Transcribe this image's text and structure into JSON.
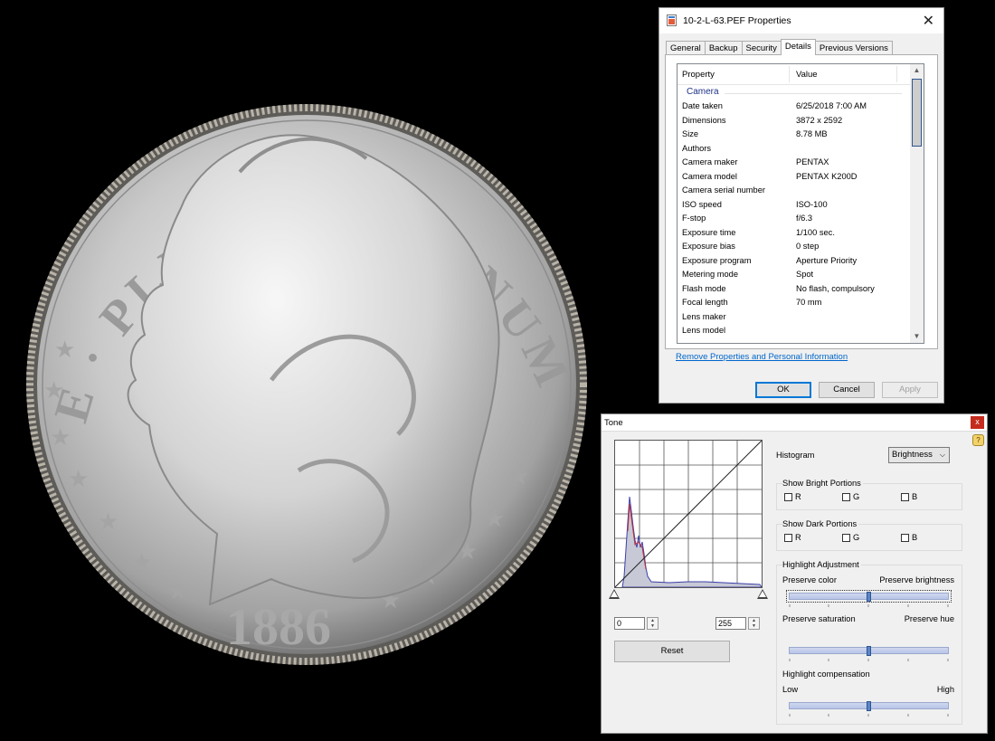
{
  "coin": {
    "legend": "E · PLURIBUS · UNUM",
    "year": "1886"
  },
  "properties": {
    "title": "10-2-L-63.PEF Properties",
    "tabs": [
      "General",
      "Backup",
      "Security",
      "Details",
      "Previous Versions"
    ],
    "active_tab": "Details",
    "columns": {
      "property": "Property",
      "value": "Value"
    },
    "group": "Camera",
    "rows": [
      {
        "property": "Date taken",
        "value": "6/25/2018 7:00 AM"
      },
      {
        "property": "Dimensions",
        "value": "3872 x 2592"
      },
      {
        "property": "Size",
        "value": "8.78 MB"
      },
      {
        "property": "Authors",
        "value": ""
      },
      {
        "property": "Camera maker",
        "value": "PENTAX"
      },
      {
        "property": "Camera model",
        "value": "PENTAX K200D"
      },
      {
        "property": "Camera serial number",
        "value": ""
      },
      {
        "property": "ISO speed",
        "value": "ISO-100"
      },
      {
        "property": "F-stop",
        "value": "f/6.3"
      },
      {
        "property": "Exposure time",
        "value": "1/100 sec."
      },
      {
        "property": "Exposure bias",
        "value": "0 step"
      },
      {
        "property": "Exposure program",
        "value": "Aperture Priority"
      },
      {
        "property": "Metering mode",
        "value": "Spot"
      },
      {
        "property": "Flash mode",
        "value": "No flash, compulsory"
      },
      {
        "property": "Focal length",
        "value": "70 mm"
      },
      {
        "property": "Lens maker",
        "value": ""
      },
      {
        "property": "Lens model",
        "value": ""
      }
    ],
    "remove_link": "Remove Properties and Personal Information",
    "buttons": {
      "ok": "OK",
      "cancel": "Cancel",
      "apply": "Apply"
    }
  },
  "tone": {
    "title": "Tone",
    "close": "x",
    "help": "?",
    "input_low": "0",
    "input_high": "255",
    "reset": "Reset",
    "histogram_label": "Histogram",
    "histogram_value": "Brightness",
    "bright_title": "Show Bright Portions",
    "dark_title": "Show Dark Portions",
    "channels": [
      "R",
      "G",
      "B"
    ],
    "highlight_title": "Highlight Adjustment",
    "preserve_color": "Preserve color",
    "preserve_brightness": "Preserve brightness",
    "preserve_saturation": "Preserve saturation",
    "preserve_hue": "Preserve hue",
    "highlight_comp": "Highlight compensation",
    "low": "Low",
    "high": "High",
    "slider_levels": {
      "color_brightness": 0.5,
      "saturation_hue": 0.5,
      "compensation": 0.5
    }
  }
}
